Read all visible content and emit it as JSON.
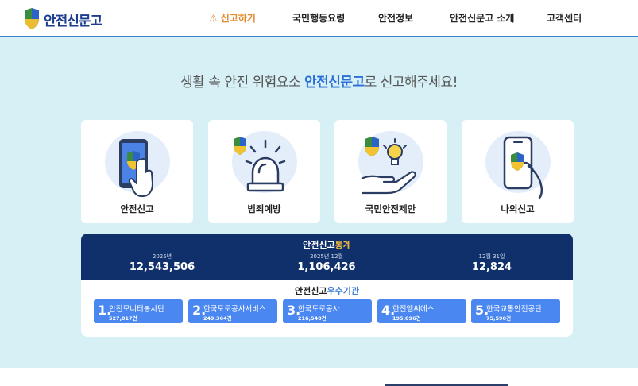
{
  "brand": {
    "name": "안전신문고",
    "icon": "shield-logo-icon"
  },
  "nav": {
    "report": "신고하기",
    "action_guide": "국민행동요령",
    "safety_info": "안전정보",
    "about": "안전신문고 소개",
    "support": "고객센터"
  },
  "hero": {
    "headline_pre": "생활 속 안전 위험요소 ",
    "headline_brand": "안전신문고",
    "headline_post": "로 신고해주세요!"
  },
  "cards": [
    {
      "label": "안전신고",
      "icon": "phone-tap-icon"
    },
    {
      "label": "범죄예방",
      "icon": "siren-icon"
    },
    {
      "label": "국민안전제안",
      "icon": "idea-hand-icon"
    },
    {
      "label": "나의신고",
      "icon": "my-phone-icon"
    }
  ],
  "stats": {
    "title_a": "안전신고",
    "title_b": "통계",
    "items": [
      {
        "caption": "2025년",
        "value": "12,543,506"
      },
      {
        "caption": "2025년 12월",
        "value": "1,106,426"
      },
      {
        "caption": "12월 31일",
        "value": "12,824"
      }
    ]
  },
  "best": {
    "title_a": "안전신고",
    "title_b": "우수기관",
    "orgs": [
      {
        "rank": "1.",
        "name": "안전모니터봉사단",
        "count": "527,017건"
      },
      {
        "rank": "2.",
        "name": "한국도로공사서비스",
        "count": "249,364건"
      },
      {
        "rank": "3.",
        "name": "한국도로공사",
        "count": "216,548건"
      },
      {
        "rank": "4.",
        "name": "한전엠씨에스",
        "count": "195,096건"
      },
      {
        "rank": "5.",
        "name": "한국교통안전공단",
        "count": "75,590건"
      }
    ]
  },
  "colors": {
    "accent": "#3d7fd6",
    "navy": "#10306b",
    "report_orange": "#e08a2c",
    "hero_bg": "#d7f0f6",
    "org_blue": "#4b87f0"
  }
}
